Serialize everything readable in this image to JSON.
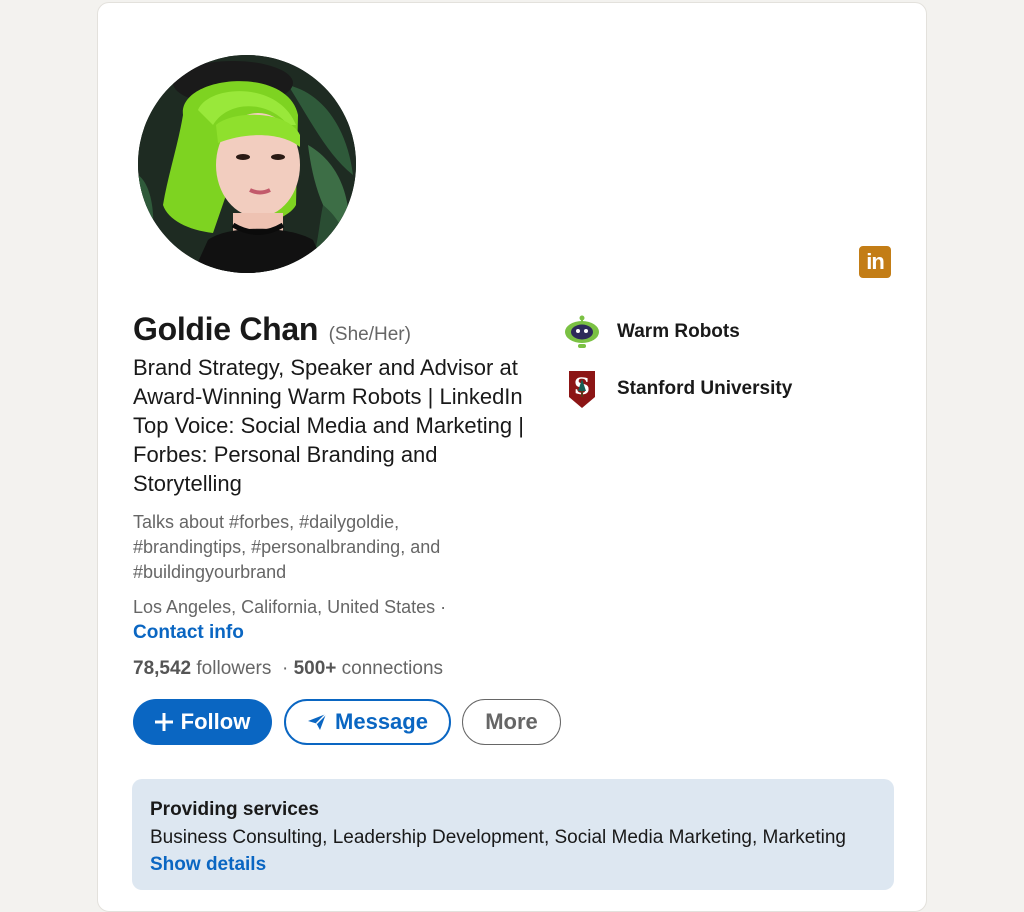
{
  "profile": {
    "name": "Goldie Chan",
    "pronouns": "(She/Her)",
    "headline": "Brand Strategy, Speaker and Advisor at Award-Winning Warm Robots | LinkedIn Top Voice: Social Media and Marketing | Forbes: Personal Branding and Storytelling",
    "talks_about": "Talks about #forbes, #dailygoldie, #brandingtips, #personalbranding, and #buildingyourbrand",
    "location": "Los Angeles, California, United States ·",
    "contact_info": "Contact info",
    "followers_count": "78,542",
    "followers_label": "followers",
    "separator": "·",
    "connections_count": "500+",
    "connections_label": "connections",
    "linkedin_badge": "in"
  },
  "actions": {
    "follow": "Follow",
    "message": "Message",
    "more": "More"
  },
  "organizations": [
    {
      "name": "Warm Robots",
      "icon": "warm-robots-logo-icon"
    },
    {
      "name": "Stanford University",
      "icon": "stanford-logo-icon"
    }
  ],
  "services": {
    "title": "Providing services",
    "list": "Business Consulting, Leadership Development, Social Media Marketing, Marketing",
    "link": "Show details"
  },
  "colors": {
    "accent": "#0a66c2",
    "background": "#f3f2ef",
    "services_bg": "#dde7f1",
    "badge": "#c37d16"
  }
}
